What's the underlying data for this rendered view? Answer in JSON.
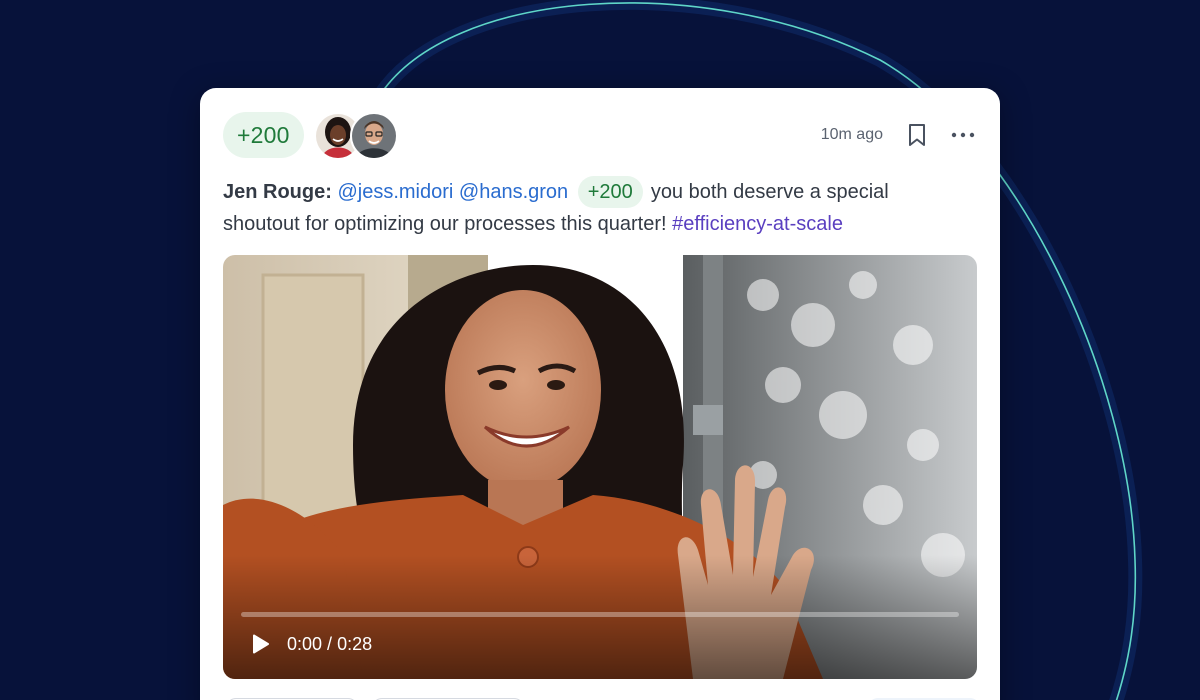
{
  "post": {
    "points_badge": "+200",
    "recipients": [
      {
        "name": "jess.midori"
      },
      {
        "name": "hans.gron"
      }
    ],
    "timestamp": "10m ago",
    "author": "Jen Rouge:",
    "mentions": [
      "@jess.midori",
      "@hans.gron"
    ],
    "inline_points": "+200",
    "message_line_1": "you both deserve a special",
    "message_line_2": "shoutout for optimizing our processes this quarter!",
    "hashtag": "#efficiency-at-scale"
  },
  "video": {
    "current_time": "0:00",
    "separator": " / ",
    "duration": "0:28",
    "progress": 0
  },
  "icons": {
    "bookmark": "bookmark-icon",
    "more": "more-options-icon",
    "play": "play-icon"
  },
  "colors": {
    "background": "#07123a",
    "ring": "#5fd6c8",
    "points_green": "#1f7a3a",
    "points_bg": "#e8f5ec",
    "mention_blue": "#2a6ccf",
    "hashtag_purple": "#5a3fc0"
  }
}
